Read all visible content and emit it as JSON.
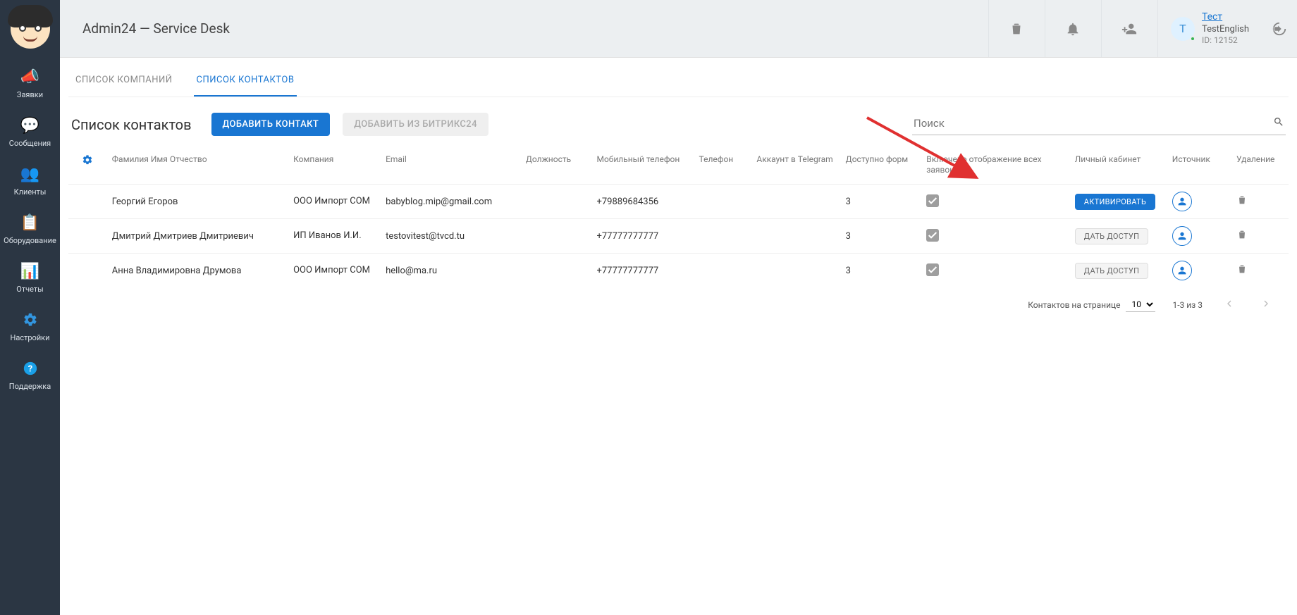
{
  "app": {
    "title": "Admin24 — Service Desk"
  },
  "user": {
    "initial": "Т",
    "name": "Тест",
    "sub": "TestEnglish",
    "id_label": "ID: 12152"
  },
  "sidebar": {
    "items": [
      {
        "label": "Заявки"
      },
      {
        "label": "Сообщения"
      },
      {
        "label": "Клиенты"
      },
      {
        "label": "Оборудование"
      },
      {
        "label": "Отчеты"
      },
      {
        "label": "Настройки"
      },
      {
        "label": "Поддержка"
      }
    ]
  },
  "tabs": {
    "companies": "СПИСОК КОМПАНИЙ",
    "contacts": "СПИСОК КОНТАКТОВ"
  },
  "toolbar": {
    "heading": "Список контактов",
    "add_contact": "ДОБАВИТЬ КОНТАКТ",
    "add_from_bitrix": "ДОБАВИТЬ ИЗ БИТРИКС24",
    "search_placeholder": "Поиск"
  },
  "table": {
    "headers": {
      "fio": "Фамилия Имя Отчество",
      "company": "Компания",
      "email": "Email",
      "position": "Должность",
      "mobile": "Мобильный телефон",
      "phone": "Телефон",
      "telegram": "Аккаунт в Telegram",
      "forms": "Доступно форм",
      "showall": "Включено отображение всех заявок",
      "cabinet": "Личный кабинет",
      "source": "Источник",
      "delete": "Удаление"
    },
    "rows": [
      {
        "fio": "Георгий Егоров",
        "company": "ООО Импорт COM",
        "email": "babyblog.mip@gmail.com",
        "position": "",
        "mobile": "+79889684356",
        "phone": "",
        "telegram": "",
        "forms": "3",
        "cabinet_label": "АКТИВИРОВАТЬ",
        "cabinet_kind": "activate"
      },
      {
        "fio": "Дмитрий Дмитриев Дмитриевич",
        "company": "ИП Иванов И.И.",
        "email": "testovitest@tvcd.tu",
        "position": "",
        "mobile": "+77777777777",
        "phone": "",
        "telegram": "",
        "forms": "3",
        "cabinet_label": "ДАТЬ ДОСТУП",
        "cabinet_kind": "grant"
      },
      {
        "fio": "Анна Владимировна Друмова",
        "company": "ООО Импорт COM",
        "email": "hello@ma.ru",
        "position": "",
        "mobile": "+77777777777",
        "phone": "",
        "telegram": "",
        "forms": "3",
        "cabinet_label": "ДАТЬ ДОСТУП",
        "cabinet_kind": "grant"
      }
    ]
  },
  "pager": {
    "per_page_label": "Контактов на странице",
    "per_page_value": "10",
    "range": "1-3 из 3"
  }
}
